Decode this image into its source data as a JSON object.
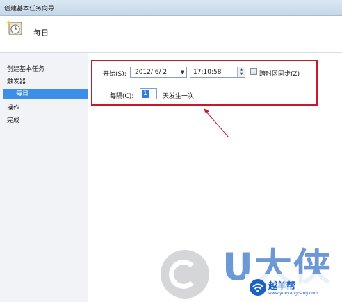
{
  "window": {
    "title": "创建基本任务向导"
  },
  "header": {
    "title": "每日"
  },
  "sidebar": {
    "items": [
      {
        "label": "创建基本任务"
      },
      {
        "label": "触发器"
      },
      {
        "label": "每日"
      },
      {
        "label": "操作"
      },
      {
        "label": "完成"
      }
    ]
  },
  "form": {
    "start_label": "开始(S):",
    "date_value": "2012/ 6/ 2",
    "time_value": "17:10:58",
    "sync_label": "跨时区同步(Z)",
    "sync_checked": false,
    "recur_label": "每隔(C):",
    "recur_value": "1",
    "recur_unit": "天发生一次"
  },
  "watermark": {
    "big_text": "U大侠",
    "brand_name": "越羊帮",
    "brand_url": "www.yueyangbang.com"
  },
  "colors": {
    "selection": "#3d8ee8",
    "highlight": "#c8192b",
    "brand": "#1a63c4"
  }
}
